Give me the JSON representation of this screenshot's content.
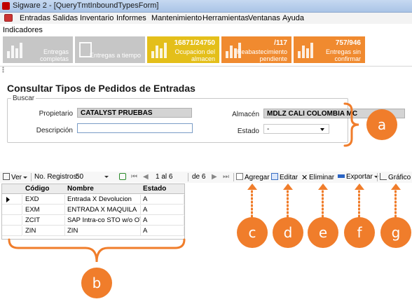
{
  "window": {
    "title": "Sigware 2 - [QueryTmtInboundTypesForm]"
  },
  "menu": {
    "items": [
      "Entradas",
      "Salidas",
      "Inventario",
      "Informes",
      "Mantenimiento",
      "Herramientas",
      "Ventanas",
      "Ayuda"
    ]
  },
  "indicators": {
    "label": "Indicadores",
    "tiles": [
      {
        "number": "",
        "line1": "Entregas",
        "line2": "completas",
        "color": "#c6c6c6"
      },
      {
        "number": "",
        "line1": "Entregas a tiempo",
        "line2": "",
        "color": "#c6c6c6"
      },
      {
        "number": "16871/24750",
        "line1": "Ocupacion del",
        "line2": "almacen",
        "color": "#e4bf1a"
      },
      {
        "number": "/117",
        "line1": "Reabastecimiento",
        "line2": "pendiente",
        "color": "#f08a2f"
      },
      {
        "number": "757/946",
        "line1": "Entregas sin",
        "line2": "confirmar",
        "color": "#f08a2f"
      }
    ]
  },
  "form": {
    "title": "Consultar Tipos de Pedidos de Entradas",
    "group_label": "Buscar",
    "propietario_label": "Propietario",
    "propietario_value": "CATALYST PRUEBAS",
    "descripcion_label": "Descripción",
    "descripcion_value": "",
    "almacen_label": "Almacén",
    "almacen_value": "MDLZ CALI COLOMBIA MC",
    "estado_label": "Estado",
    "estado_value": "-"
  },
  "toolbar": {
    "ver": "Ver",
    "records_label": "No. Registros:",
    "records_value": "50",
    "page_of": "1 al 6",
    "de": "de 6",
    "agregar": "Agregar",
    "editar": "Editar",
    "eliminar": "Eliminar",
    "exportar": "Exportar",
    "grafico": "Gráfico"
  },
  "grid": {
    "headers": [
      "Código",
      "Nombre",
      "Estado"
    ],
    "rows": [
      [
        "EXD",
        "Entrada X Devolucion",
        "A"
      ],
      [
        "EXM",
        "ENTRADA X MAQUILA",
        "A"
      ],
      [
        "ZCIT",
        "SAP Intra-co STO w/o OTM",
        "A"
      ],
      [
        "ZIN",
        "ZIN",
        "A"
      ]
    ]
  },
  "annotations": {
    "a": "a",
    "b": "b",
    "c": "c",
    "d": "d",
    "e": "e",
    "f": "f",
    "g": "g"
  },
  "colors": {
    "annotation": "#f07d2b"
  }
}
